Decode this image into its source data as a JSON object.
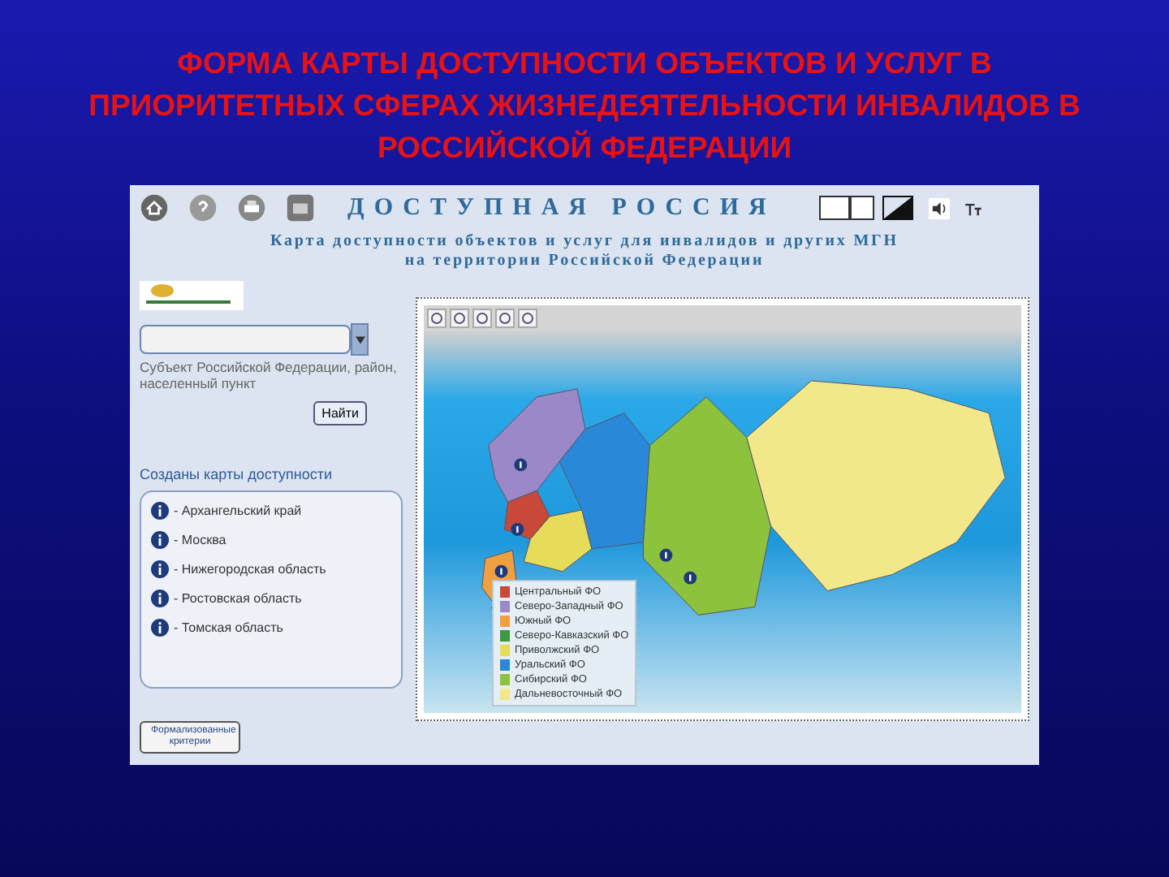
{
  "slide_title": "ФОРМА КАРТЫ ДОСТУПНОСТИ ОБЪЕКТОВ И УСЛУГ В ПРИОРИТЕТНЫХ СФЕРАХ ЖИЗНЕДЕЯТЕЛЬНОСТИ ИНВАЛИДОВ В РОССИЙСКОЙ ФЕДЕРАЦИИ",
  "site": {
    "title": "ДОСТУПНАЯ РОССИЯ",
    "subtitle_lines": [
      "Карта доступности объектов и услуг для инвалидов и других МГН",
      "на территории Российской Федерации"
    ]
  },
  "search": {
    "hint": "Субъект Российской Федерации, район, населенный пункт",
    "button": "Найти"
  },
  "maps_section": {
    "title": "Созданы карты доступности",
    "items": [
      "- Архангельский край",
      "- Москва",
      "- Нижегородская область",
      "- Ростовская область",
      "- Томская область"
    ]
  },
  "criteria_button": "Формализованные критерии",
  "legend": [
    {
      "label": "Центральный ФО",
      "color": "#c8483a"
    },
    {
      "label": "Северо-Западный ФО",
      "color": "#9a88c8"
    },
    {
      "label": "Южный ФО",
      "color": "#f0a040"
    },
    {
      "label": "Северо-Кавказский ФО",
      "color": "#3a9a40"
    },
    {
      "label": "Приволжский ФО",
      "color": "#e6dc5a"
    },
    {
      "label": "Уральский ФО",
      "color": "#2a88d8"
    },
    {
      "label": "Сибирский ФО",
      "color": "#8cc23c"
    },
    {
      "label": "Дальневосточный ФО",
      "color": "#f2e88a"
    }
  ]
}
